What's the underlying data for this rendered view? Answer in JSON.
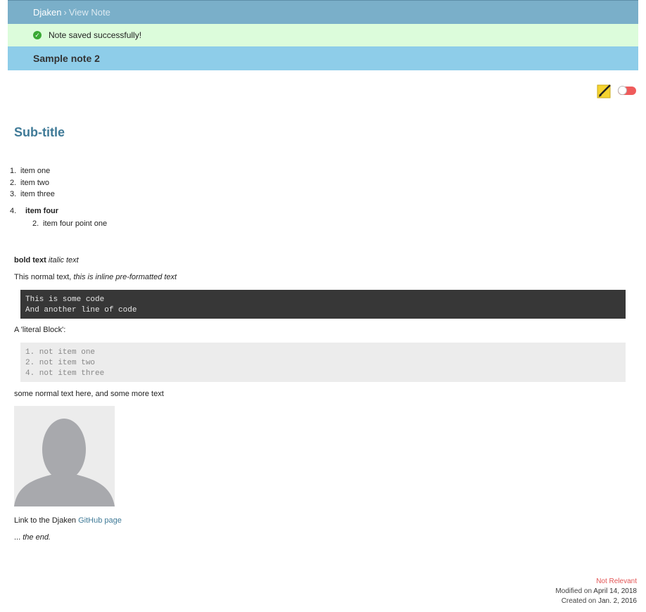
{
  "header": {
    "brand": "Djaken",
    "separator": "›",
    "crumb": "View Note"
  },
  "alert": {
    "icon": "check-circle-icon",
    "text": "Note saved successfully!"
  },
  "note": {
    "title": "Sample note 2",
    "subtitle": "Sub-title",
    "list": [
      {
        "num": "1.",
        "text": "item one"
      },
      {
        "num": "2.",
        "text": "item two"
      },
      {
        "num": "3.",
        "text": "item three"
      }
    ],
    "item4": {
      "num": "4.",
      "text": "item four"
    },
    "subitem": {
      "num": "2.",
      "text": "item four point one"
    },
    "bold_text": "bold text",
    "italic_text": "italic text",
    "normal_text": "This normal text,",
    "inline_pre": "this is inline pre-formatted text",
    "code_block": "This is some code\nAnd another line of code",
    "literal_label": "A 'literal Block':",
    "literal_block": "1. not item one\n2. not item two\n4. not item three",
    "more_text": "some normal text here, and some more text",
    "link_prefix": "Link to the Djaken",
    "link_text": "GitHub page",
    "end_prefix": "...",
    "end_text": "the end."
  },
  "tools": {
    "edit_icon": "pencil-icon",
    "toggle_state": "off"
  },
  "footer": {
    "relevance": "Not Relevant",
    "modified_label": "Modified on",
    "modified_date": "April 14, 2018",
    "created_label": "Created on",
    "created_date": "Jan. 2, 2016"
  },
  "colors": {
    "topbar": "#7aafc9",
    "alert": "#dcfcdb",
    "titlebar": "#8ecde9",
    "accent": "#3f7a97",
    "toggle": "#ef5b5b"
  }
}
